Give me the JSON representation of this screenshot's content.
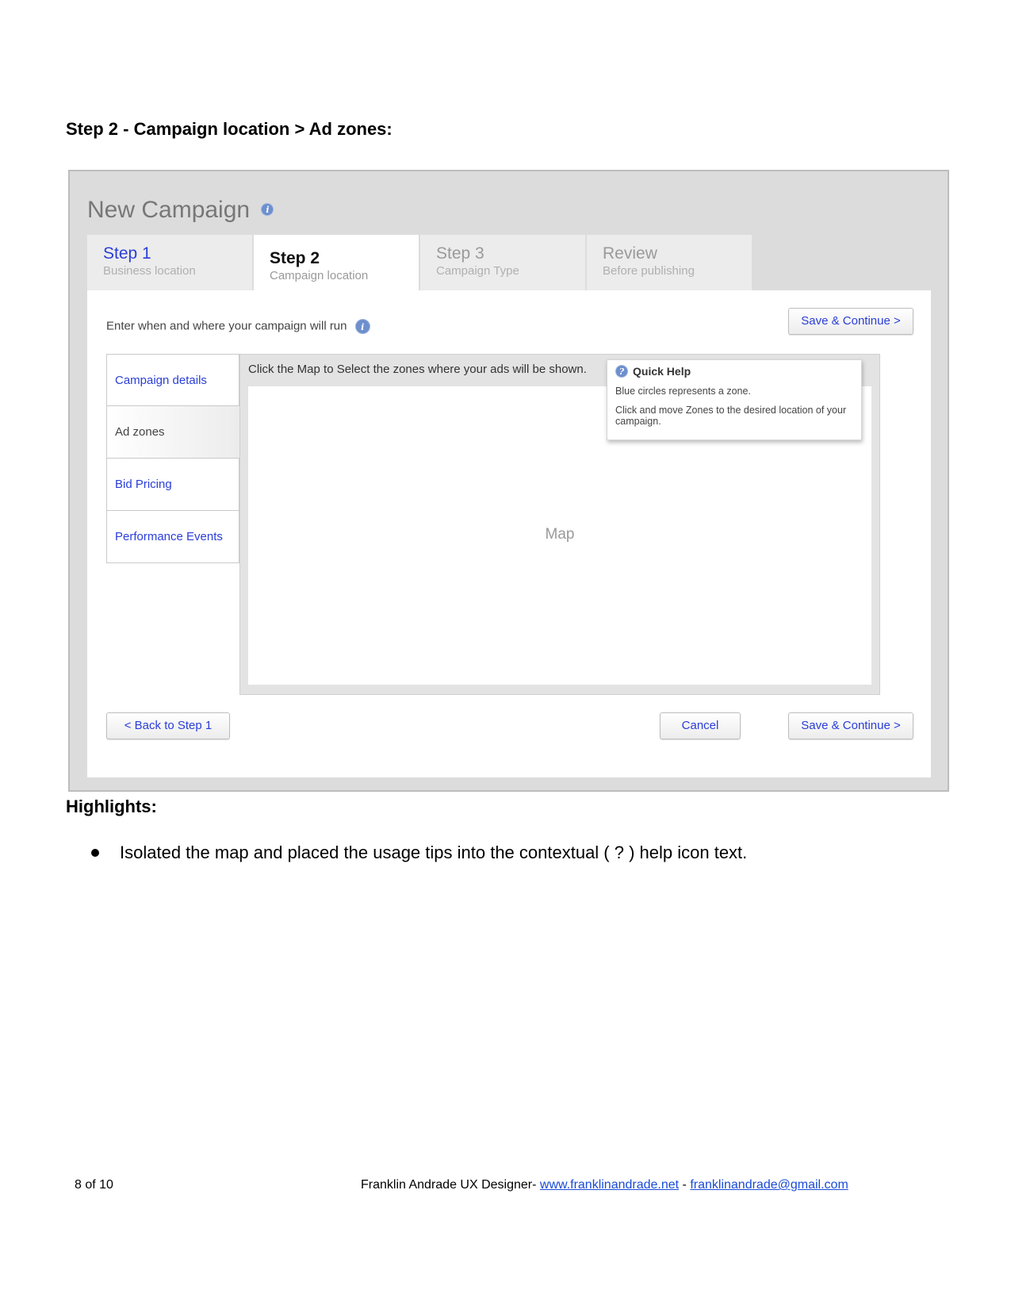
{
  "heading": "Step 2 - Campaign location > Ad zones:",
  "mockup": {
    "title": "New Campaign",
    "tabs": [
      {
        "main": "Step 1",
        "sub": "Business location"
      },
      {
        "main": "Step 2",
        "sub": "Campaign location"
      },
      {
        "main": "Step 3",
        "sub": "Campaign Type"
      },
      {
        "main": "Review",
        "sub": "Before publishing"
      }
    ],
    "instruction": "Enter when and where your campaign will run",
    "save_continue": "Save & Continue >",
    "sidenav": [
      "Campaign details",
      "Ad zones",
      "Bid Pricing",
      "Performance Events"
    ],
    "map_instruction": "Click the Map to Select the zones where your ads will be shown.",
    "map_label": "Map",
    "quick_help": {
      "title": "Quick Help",
      "line1": "Blue circles represents a zone.",
      "line2": "Click and move Zones to the desired location of your campaign."
    },
    "back": "< Back to Step 1",
    "cancel": "Cancel",
    "info_glyph": "i",
    "help_glyph": "?"
  },
  "highlights": {
    "heading": "Highlights:",
    "items": [
      "Isolated the map and placed the usage tips into the contextual ( ? ) help icon text."
    ]
  },
  "footer": {
    "page": "8 of 10",
    "credit": "Franklin Andrade UX Designer- ",
    "website": "www.franklinandrade.net",
    "separator": " - ",
    "email": "franklinandrade@gmail.com"
  }
}
